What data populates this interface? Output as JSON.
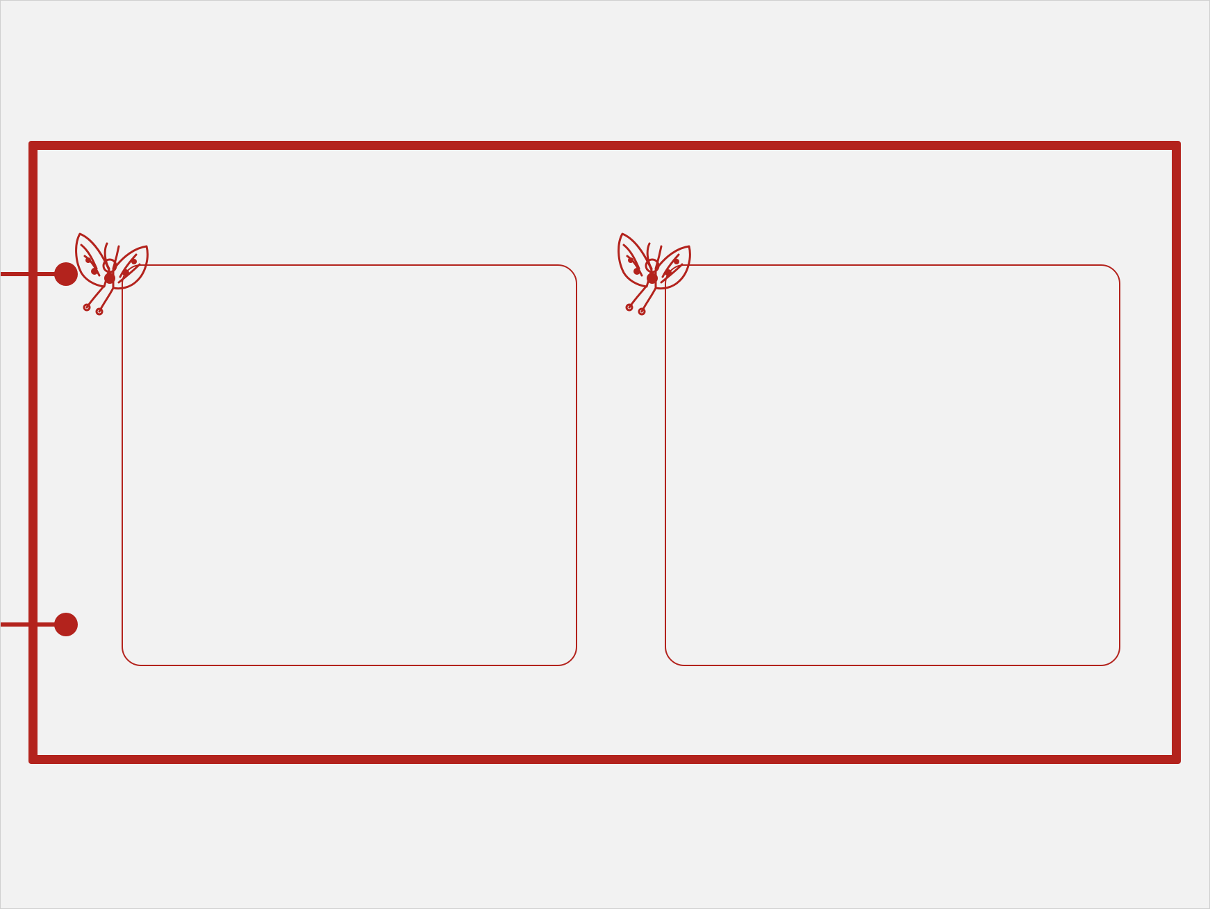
{
  "canvas": {
    "background_color": "#f2f2f2",
    "accent_color": "#b3231d"
  },
  "frame": {
    "panels": [
      {
        "id": "left",
        "content": ""
      },
      {
        "id": "right",
        "content": ""
      }
    ],
    "decoration_icon": "butterfly-icon",
    "connectors": 2
  }
}
